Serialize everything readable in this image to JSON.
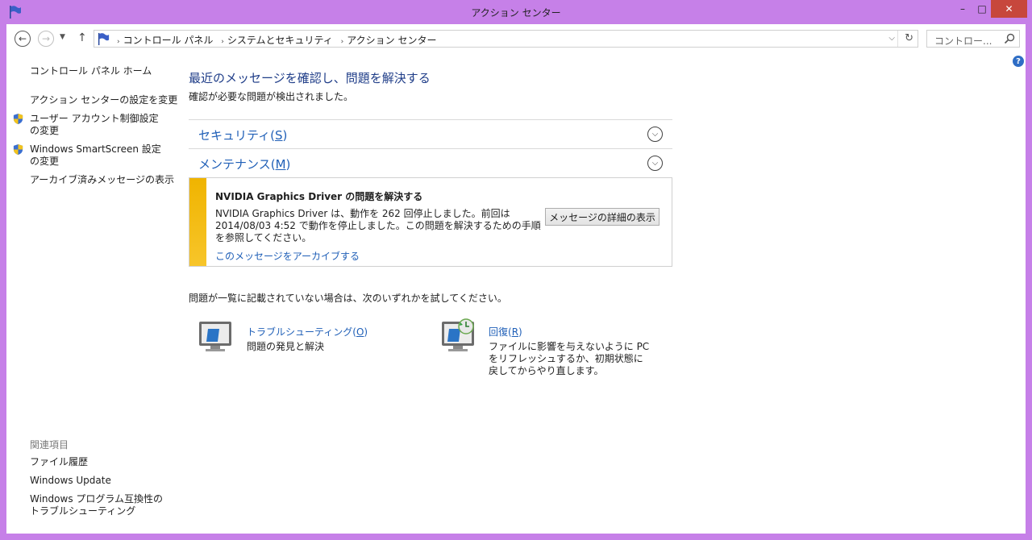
{
  "window": {
    "title": "アクション センター",
    "minimize": "–",
    "maximize": "□",
    "close": "✕"
  },
  "nav": {
    "back": "←",
    "forward": "→",
    "recent": "▼",
    "up": "↑",
    "breadcrumbs": [
      "コントロール パネル",
      "システムとセキュリティ",
      "アクション センター"
    ],
    "breadcrumb_sep": "›",
    "address_dropdown": "⌵",
    "refresh": "↻",
    "search_placeholder": "コントロー..."
  },
  "help": "?",
  "sidebar": {
    "home": "コントロール パネル ホーム",
    "items": [
      {
        "label": "アクション センターの設定を変更",
        "shield": false
      },
      {
        "label": "ユーザー アカウント制御設定の変更",
        "shield": true
      },
      {
        "label": "Windows SmartScreen 設定の変更",
        "shield": true
      },
      {
        "label": "アーカイブ済みメッセージの表示",
        "shield": false
      }
    ],
    "related_heading": "関連項目",
    "related": [
      "ファイル履歴",
      "Windows Update",
      "Windows プログラム互換性のトラブルシューティング"
    ]
  },
  "main": {
    "title": "最近のメッセージを確認し、問題を解決する",
    "subtitle": "確認が必要な問題が検出されました。",
    "sections": [
      {
        "label": "セキュリティ",
        "key": "S"
      },
      {
        "label": "メンテナンス",
        "key": "M"
      }
    ],
    "message": {
      "title": "NVIDIA Graphics Driver の問題を解決する",
      "body": "NVIDIA Graphics Driver は、動作を 262 回停止しました。前回は 2014/08/03 4:52 で動作を停止しました。この問題を解決するための手順を参照してください。",
      "button": "メッセージの詳細の表示",
      "archive_link": "このメッセージをアーカイブする",
      "bar_color": "#f5bd14"
    },
    "hint": "問題が一覧に記載されていない場合は、次のいずれかを試してください。",
    "tools": [
      {
        "label": "トラブルシューティング",
        "key": "O",
        "desc": "問題の発見と解決",
        "icon": "troubleshoot-icon"
      },
      {
        "label": "回復",
        "key": "R",
        "desc": "ファイルに影響を与えないように PC をリフレッシュするか、初期状態に戻してからやり直します。",
        "icon": "recovery-icon"
      }
    ]
  },
  "colors": {
    "frame": "#c680e8",
    "link": "#1f5fb7",
    "title": "#1f3d88",
    "close": "#c7473c"
  }
}
